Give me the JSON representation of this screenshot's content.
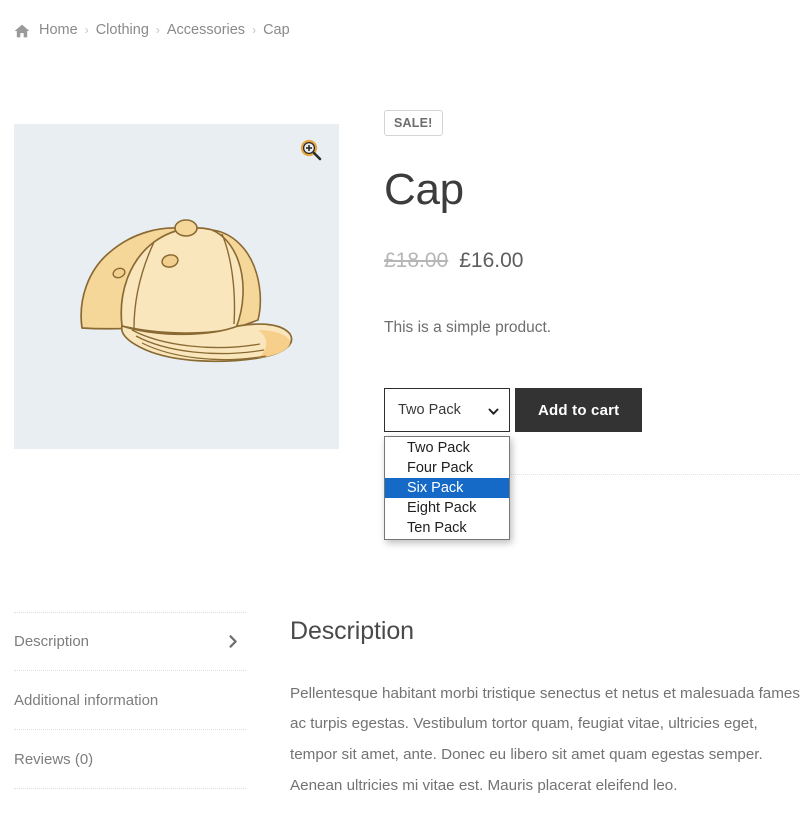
{
  "breadcrumb": {
    "home_icon": "home-icon",
    "separator": "›",
    "items": [
      {
        "label": "Home",
        "current": false
      },
      {
        "label": "Clothing",
        "current": false
      },
      {
        "label": "Accessories",
        "current": false
      },
      {
        "label": "Cap",
        "current": true
      }
    ]
  },
  "product": {
    "sale_badge": "SALE!",
    "title": "Cap",
    "price_old": "£18.00",
    "price_new": "£16.00",
    "short_description": "This is a simple product.",
    "image_alt": "cap-product-image",
    "zoom_icon": "magnifier-plus-icon"
  },
  "variation_form": {
    "select": {
      "name": "pack-size-select",
      "selected_value": "Two Pack",
      "expanded": true,
      "highlighted_option": "Six Pack",
      "options": [
        "Two Pack",
        "Four Pack",
        "Six Pack",
        "Eight Pack",
        "Ten Pack"
      ]
    },
    "add_to_cart_label": "Add to cart"
  },
  "tabs": {
    "items": [
      {
        "label": "Description",
        "active": true
      },
      {
        "label": "Additional information",
        "active": false
      },
      {
        "label": "Reviews (0)",
        "active": false
      }
    ],
    "active_chevron_icon": "chevron-right-icon"
  },
  "panel": {
    "title": "Description",
    "body": "Pellentesque habitant morbi tristique senectus et netus et malesuada fames ac turpis egestas. Vestibulum tortor quam, feugiat vitae, ultricies eget, tempor sit amet, ante. Donec eu libero sit amet quam egestas semper. Aenean ultricies mi vitae est. Mauris placerat eleifend leo."
  },
  "colors": {
    "gallery_background": "#e9eef2",
    "button_background": "#333333",
    "dropdown_highlight": "#1569c7",
    "text_muted": "#8a8a8a",
    "cap_fill": "#f7dca4"
  }
}
